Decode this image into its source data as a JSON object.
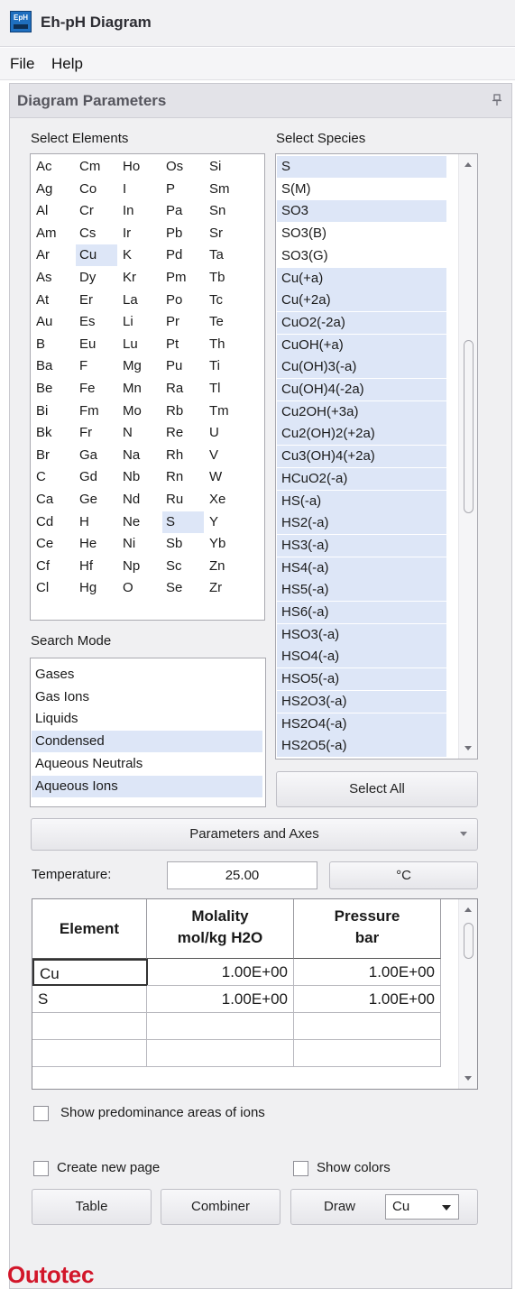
{
  "window": {
    "title": "Eh-pH Diagram",
    "icon_text": "EpH"
  },
  "menu": [
    "File",
    "Help"
  ],
  "panel": {
    "title": "Diagram Parameters"
  },
  "elements_list": {
    "label": "Select Elements",
    "columns": [
      [
        "Ac",
        "Ag",
        "Al",
        "Am",
        "Ar",
        "As",
        "At",
        "Au",
        "B",
        "Ba",
        "Be",
        "Bi",
        "Bk",
        "Br",
        "C",
        "Ca",
        "Cd",
        "Ce",
        "Cf",
        "Cl"
      ],
      [
        "Cm",
        "Co",
        "Cr",
        "Cs",
        "Cu",
        "Dy",
        "Er",
        "Es",
        "Eu",
        "F",
        "Fe",
        "Fm",
        "Fr",
        "Ga",
        "Gd",
        "Ge",
        "H",
        "He",
        "Hf",
        "Hg"
      ],
      [
        "Ho",
        "I",
        "In",
        "Ir",
        "K",
        "Kr",
        "La",
        "Li",
        "Lu",
        "Mg",
        "Mn",
        "Mo",
        "N",
        "Na",
        "Nb",
        "Nd",
        "Ne",
        "Ni",
        "Np",
        "O"
      ],
      [
        "Os",
        "P",
        "Pa",
        "Pb",
        "Pd",
        "Pm",
        "Po",
        "Pr",
        "Pt",
        "Pu",
        "Ra",
        "Rb",
        "Re",
        "Rh",
        "Rn",
        "Ru",
        "S",
        "Sb",
        "Sc",
        "Se"
      ],
      [
        "Si",
        "Sm",
        "Sn",
        "Sr",
        "Ta",
        "Tb",
        "Tc",
        "Te",
        "Th",
        "Ti",
        "Tl",
        "Tm",
        "U",
        "V",
        "W",
        "Xe",
        "Y",
        "Yb",
        "Zn",
        "Zr"
      ]
    ],
    "selected": [
      "Cu",
      "S"
    ]
  },
  "species_list": {
    "label": "Select Species",
    "items": [
      {
        "text": "S",
        "selected": true
      },
      {
        "text": "S(M)",
        "selected": false
      },
      {
        "text": "SO3",
        "selected": true
      },
      {
        "text": "SO3(B)",
        "selected": false
      },
      {
        "text": "SO3(G)",
        "selected": false
      },
      {
        "text": "Cu(+a)",
        "selected": true
      },
      {
        "text": "Cu(+2a)",
        "selected": true
      },
      {
        "text": "CuO2(-2a)",
        "selected": true
      },
      {
        "text": "CuOH(+a)",
        "selected": true
      },
      {
        "text": "Cu(OH)3(-a)",
        "selected": true
      },
      {
        "text": "Cu(OH)4(-2a)",
        "selected": true
      },
      {
        "text": "Cu2OH(+3a)",
        "selected": true
      },
      {
        "text": "Cu2(OH)2(+2a)",
        "selected": true
      },
      {
        "text": "Cu3(OH)4(+2a)",
        "selected": true
      },
      {
        "text": "HCuO2(-a)",
        "selected": true
      },
      {
        "text": "HS(-a)",
        "selected": true
      },
      {
        "text": "HS2(-a)",
        "selected": true
      },
      {
        "text": "HS3(-a)",
        "selected": true
      },
      {
        "text": "HS4(-a)",
        "selected": true
      },
      {
        "text": "HS5(-a)",
        "selected": true
      },
      {
        "text": "HS6(-a)",
        "selected": true
      },
      {
        "text": "HSO3(-a)",
        "selected": true
      },
      {
        "text": "HSO4(-a)",
        "selected": true
      },
      {
        "text": "HSO5(-a)",
        "selected": true
      },
      {
        "text": "HS2O3(-a)",
        "selected": true
      },
      {
        "text": "HS2O4(-a)",
        "selected": true
      },
      {
        "text": "HS2O5(-a)",
        "selected": true
      }
    ],
    "scroll_position": 0.4
  },
  "search_mode": {
    "label": "Search Mode",
    "items": [
      {
        "text": "Gases",
        "selected": false
      },
      {
        "text": "Gas Ions",
        "selected": false
      },
      {
        "text": "Liquids",
        "selected": false
      },
      {
        "text": "Condensed",
        "selected": true
      },
      {
        "text": "Aqueous Neutrals",
        "selected": false
      },
      {
        "text": "Aqueous Ions",
        "selected": true
      }
    ]
  },
  "buttons": {
    "select_all": "Select All",
    "parameters_axes": "Parameters and Axes",
    "table": "Table",
    "combiner": "Combiner",
    "draw": "Draw"
  },
  "temperature": {
    "label": "Temperature:",
    "value": "25.00",
    "unit": "°C"
  },
  "conditions_table": {
    "headers": [
      {
        "line1": "Element",
        "line2": ""
      },
      {
        "line1": "Molality",
        "line2": "mol/kg H2O"
      },
      {
        "line1": "Pressure",
        "line2": "bar"
      }
    ],
    "rows": [
      [
        "Cu",
        "1.00E+00",
        "1.00E+00"
      ],
      [
        "S",
        "1.00E+00",
        "1.00E+00"
      ],
      [
        "",
        "",
        ""
      ],
      [
        "",
        "",
        ""
      ]
    ]
  },
  "checkboxes": {
    "predominance": "Show predominance areas of ions",
    "new_page": "Create new page",
    "show_colors": "Show colors"
  },
  "draw_select": {
    "value": "Cu"
  },
  "brand": "Outotec"
}
